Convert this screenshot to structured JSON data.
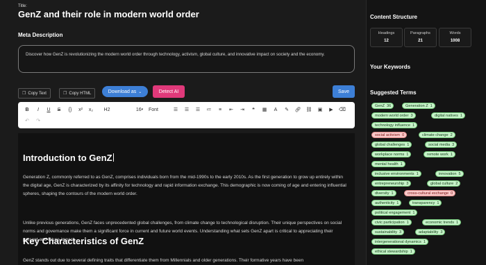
{
  "title_label": "Title:",
  "title": "GenZ and their role in modern world order",
  "meta": {
    "label": "Meta Description",
    "text": "Discover how GenZ is revolutionizing the modern world order through technology, activism, global culture, and innovative impact on society and the economy."
  },
  "toolbar": {
    "copy_text": "Copy Text",
    "copy_html": "Copy HTML",
    "download": "Download as",
    "detect": "Detect AI",
    "save": "Save"
  },
  "editor_tools": {
    "heading": "H2",
    "font_size": "16",
    "font": "Font"
  },
  "content": {
    "h1": "Introduction to GenZ",
    "p1": "Generation Z, commonly referred to as GenZ, comprises individuals born from the mid-1990s to the early 2010s. As the first generation to grow up entirely within the digital age, GenZ is characterized by its affinity for technology and rapid information exchange. This demographic is now coming of age and entering influential spheres, shaping the contours of the modern world order.",
    "p2": "Unlike previous generations, GenZ faces unprecedented global challenges, from climate change to technological disruption. Their unique perspectives on social norms and governance make them a significant force in current and future world events. Understanding what sets GenZ apart is critical to appreciating their present and future impact.",
    "h2": "Key Characteristics of GenZ",
    "p3": "GenZ stands out due to several defining traits that differentiate them from Millennials and older generations. Their formative years have been"
  },
  "sidebar": {
    "structure_title": "Content Structure",
    "stats": [
      {
        "label": "Headings",
        "value": "12"
      },
      {
        "label": "Paragraphs",
        "value": "21"
      },
      {
        "label": "Words",
        "value": "1008"
      }
    ],
    "keywords_title": "Your Keywords",
    "suggested_title": "Suggested Terms",
    "terms": [
      {
        "term": "GenZ",
        "count": "36",
        "status": "green"
      },
      {
        "term": "Generation Z",
        "count": "1",
        "status": "green"
      },
      {
        "term": "modern world order",
        "count": "3",
        "status": "green"
      },
      {
        "term": "digital natives",
        "count": "1",
        "status": "green"
      },
      {
        "term": "technology influence",
        "count": "1",
        "status": "green"
      },
      {
        "term": "social activism",
        "count": "0",
        "status": "red"
      },
      {
        "term": "climate change",
        "count": "2",
        "status": "green"
      },
      {
        "term": "global challenges",
        "count": "1",
        "status": "green"
      },
      {
        "term": "social media",
        "count": "3",
        "status": "green"
      },
      {
        "term": "workplace norms",
        "count": "1",
        "status": "green"
      },
      {
        "term": "remote work",
        "count": "1",
        "status": "green"
      },
      {
        "term": "mental health",
        "count": "1",
        "status": "green"
      },
      {
        "term": "inclusive environments",
        "count": "1",
        "status": "green"
      },
      {
        "term": "innovation",
        "count": "5",
        "status": "green"
      },
      {
        "term": "entrepreneurship",
        "count": "3",
        "status": "green"
      },
      {
        "term": "global culture",
        "count": "2",
        "status": "green"
      },
      {
        "term": "diversity",
        "count": "1",
        "status": "green"
      },
      {
        "term": "cross-cultural exchange",
        "count": "0",
        "status": "red"
      },
      {
        "term": "authenticity",
        "count": "1",
        "status": "green"
      },
      {
        "term": "transparency",
        "count": "1",
        "status": "green"
      },
      {
        "term": "political engagement",
        "count": "1",
        "status": "green"
      },
      {
        "term": "civic participation",
        "count": "1",
        "status": "green"
      },
      {
        "term": "economic trends",
        "count": "1",
        "status": "green"
      },
      {
        "term": "sustainability",
        "count": "3",
        "status": "green"
      },
      {
        "term": "adaptability",
        "count": "3",
        "status": "green"
      },
      {
        "term": "intergenerational dynamics",
        "count": "1",
        "status": "green"
      },
      {
        "term": "ethical stewardship",
        "count": "1",
        "status": "green"
      }
    ]
  }
}
